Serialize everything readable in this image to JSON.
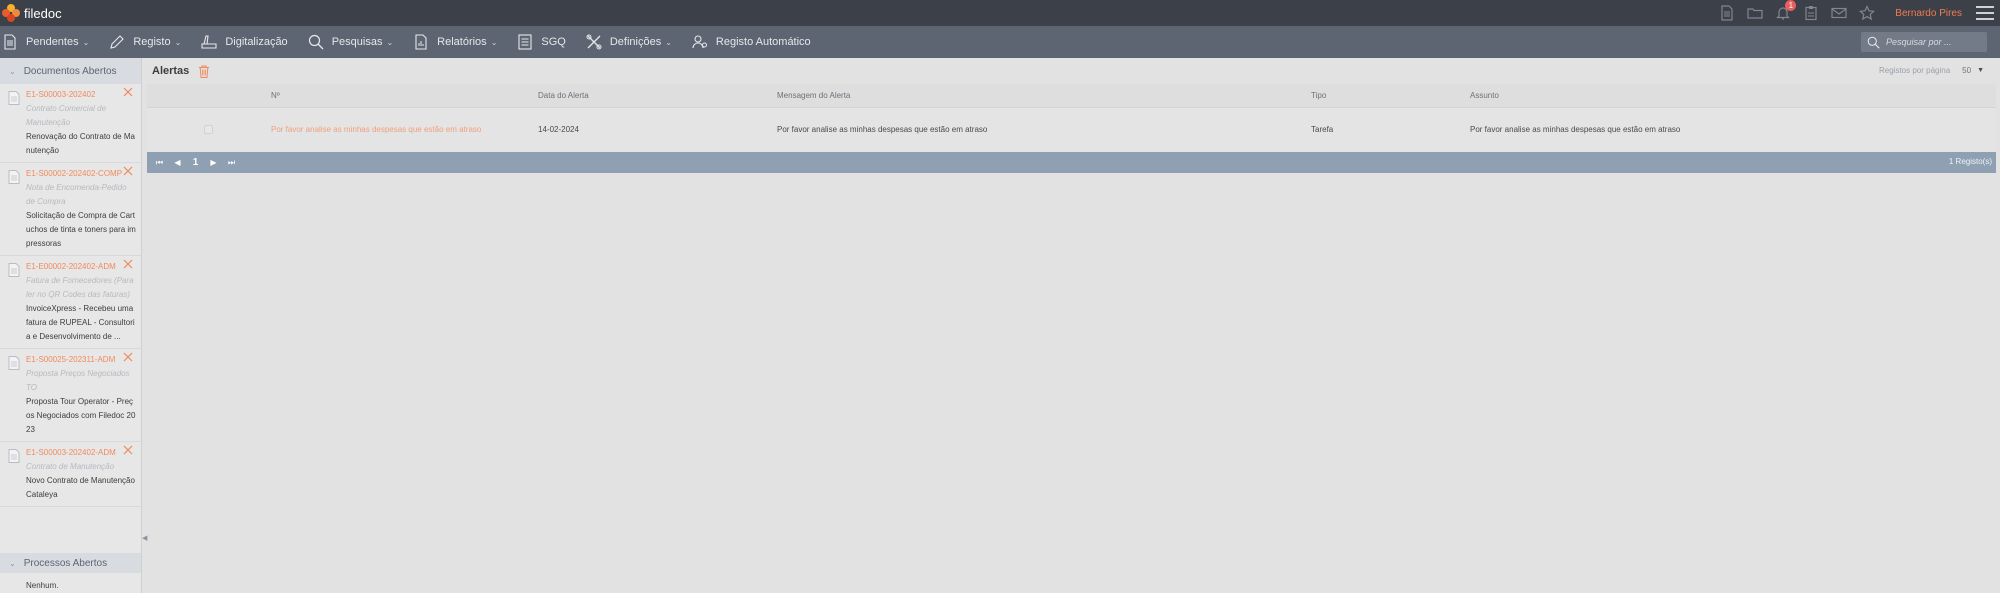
{
  "app": {
    "name": "filedoc"
  },
  "topbar": {
    "user": "Bernardo Pires",
    "notification_count": "1",
    "icons": [
      "document-icon",
      "folder-icon",
      "bell-icon",
      "clipboard-icon",
      "mail-icon",
      "star-icon",
      "menu-icon"
    ]
  },
  "nav": {
    "items": [
      {
        "label": "Pendentes",
        "icon": "document-icon",
        "dropdown": true
      },
      {
        "label": "Registo",
        "icon": "pencil-icon",
        "dropdown": true
      },
      {
        "label": "Digitalização",
        "icon": "scanner-icon",
        "dropdown": false
      },
      {
        "label": "Pesquisas",
        "icon": "search-icon",
        "dropdown": true
      },
      {
        "label": "Relatórios",
        "icon": "report-icon",
        "dropdown": true
      },
      {
        "label": "SGQ",
        "icon": "checklist-icon",
        "dropdown": false
      },
      {
        "label": "Definições",
        "icon": "tools-icon",
        "dropdown": true
      },
      {
        "label": "Registo Automático",
        "icon": "user-gear-icon",
        "dropdown": false
      }
    ],
    "search_placeholder": "Pesquisar por ..."
  },
  "sidebar": {
    "documents_header": "Documentos Abertos",
    "documents": [
      {
        "code": "E1-S00003-202402",
        "type": "Contrato Comercial de Manutenção",
        "desc": "Renovação do Contrato de Manutenção"
      },
      {
        "code": "E1-S00002-202402-COMP",
        "type": "Nota de Encomenda-Pedido de Compra",
        "desc": "Solicitação de Compra de Cartuchos de tinta e toners para impressoras"
      },
      {
        "code": "E1-E00002-202402-ADM",
        "type": "Fatura de Fornecedores (Para ler no QR Codes das faturas)",
        "desc": "InvoiceXpress - Recebeu uma fatura de RUPEAL - Consultoria e Desenvolvimento de ..."
      },
      {
        "code": "E1-S00025-202311-ADM",
        "type": "Proposta Preços Negociados TO",
        "desc": "Proposta Tour Operator - Preços Negociados com Filedoc 2023"
      },
      {
        "code": "E1-S00003-202402-ADM",
        "type": "Contrato de Manutenção",
        "desc": "Novo Contrato de Manutenção Cataleya"
      }
    ],
    "processes_header": "Processos Abertos",
    "processes_empty": "Nenhum."
  },
  "main": {
    "title": "Alertas",
    "per_page_label": "Registos por página",
    "per_page_value": "50",
    "columns": [
      "Nº",
      "Data do Alerta",
      "Mensagem do Alerta",
      "Tipo",
      "Assunto"
    ],
    "rows": [
      {
        "numero": "Por favor analise as minhas despesas que estão em atraso",
        "data": "14-02-2024",
        "mensagem": "Por favor analise as minhas despesas que estão em atraso",
        "tipo": "Tarefa",
        "assunto": "Por favor analise as minhas despesas que estão em atraso"
      }
    ],
    "pager": {
      "first": "⏮",
      "prev": "◀",
      "page": "1",
      "next": "▶",
      "last": "⏭",
      "count": "1 Registo(s)"
    }
  },
  "colors": {
    "accent": "#f07b4f",
    "topbar": "#3c4048",
    "navbar": "#5d6572",
    "pager": "#8fa0b3"
  }
}
